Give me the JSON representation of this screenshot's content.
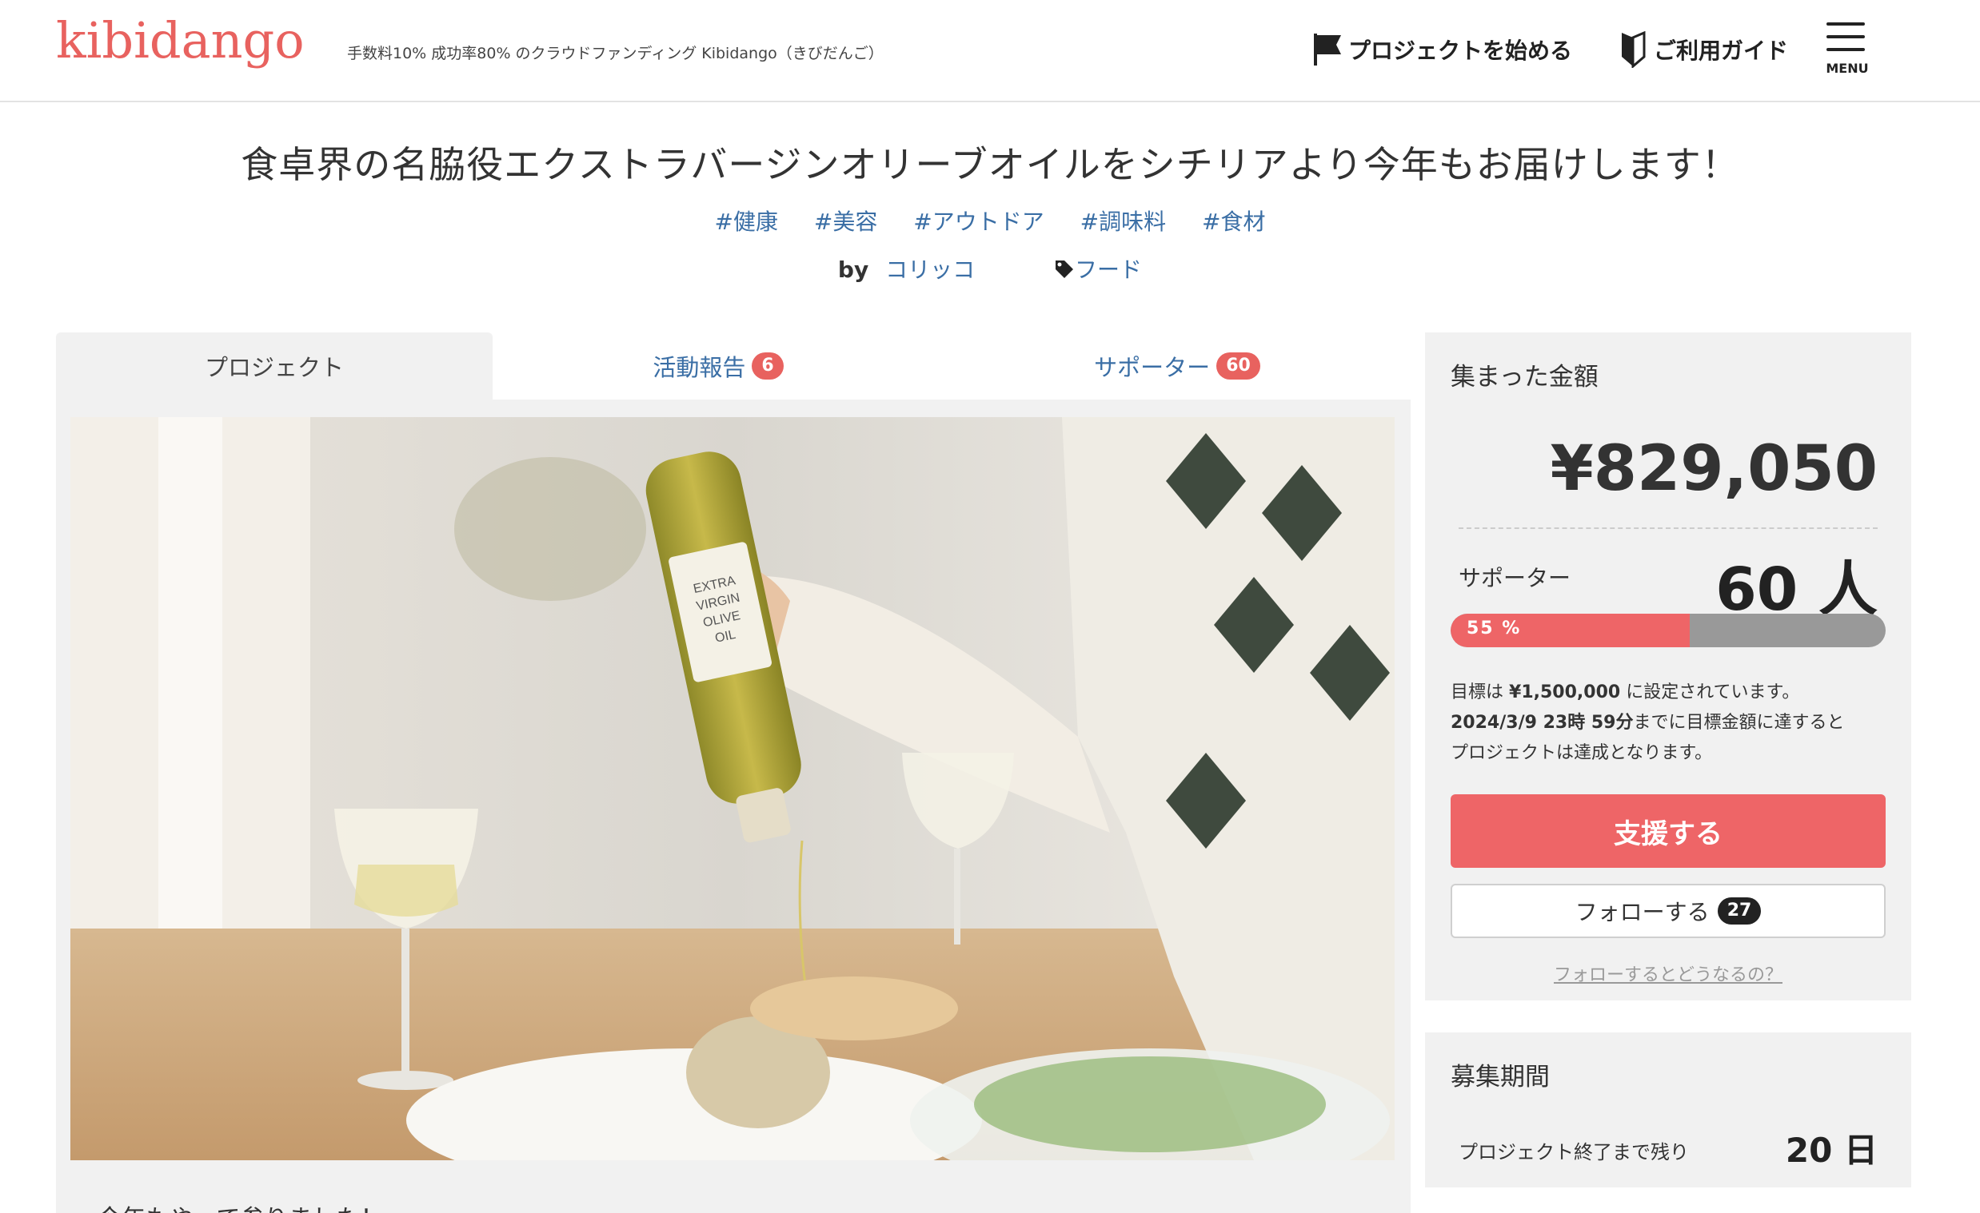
{
  "header": {
    "logo": "kibidango",
    "tagline": "手数料10% 成功率80% のクラウドファンディング Kibidango（きびだんご）",
    "start_project": "プロジェクトを始める",
    "guide": "ご利用ガイド",
    "menu_label": "MENU"
  },
  "project": {
    "title": "食卓界の名脇役エクストラバージンオリーブオイルをシチリアより今年もお届けします！",
    "tags": [
      "#健康",
      "#美容",
      "#アウトドア",
      "#調味料",
      "#食材"
    ],
    "by_label": "by",
    "owner": "コリッコ",
    "category": "フード",
    "intro_text": "今年もやって参りました！"
  },
  "tabs": [
    {
      "label": "プロジェクト",
      "count": ""
    },
    {
      "label": "活動報告",
      "count": "6"
    },
    {
      "label": "サポーター",
      "count": "60"
    }
  ],
  "hero_image": {
    "bottle_label_line1": "EXTRA",
    "bottle_label_line2": "VIRGIN",
    "bottle_label_line3": "OLIVE",
    "bottle_label_line4": "OIL"
  },
  "funding": {
    "heading": "集まった金額",
    "amount": "¥829,050",
    "supporters_label": "サポーター",
    "supporters_value": "60 人",
    "progress_percent": 55,
    "progress_text": "55 %",
    "goal_prefix": "目標は",
    "goal_amount": "¥1,500,000",
    "goal_suffix": "に設定されています。",
    "deadline": "2024/3/9 23時 59分",
    "deadline_suffix": "までに目標金額に達すると",
    "deadline_line2": "プロジェクトは達成となります。",
    "support_button": "支援する",
    "follow_button": "フォローする",
    "follow_count": "27",
    "follow_help": "フォローするとどうなるの？"
  },
  "period": {
    "heading": "募集期間",
    "remaining_label": "プロジェクト終了まで残り",
    "remaining_value": "20 日"
  },
  "colors": {
    "brand": "#e8625f",
    "link": "#3a6ea5",
    "panel": "#f1f1f1",
    "progress_fill": "#ee6567",
    "progress_track": "#999999"
  }
}
